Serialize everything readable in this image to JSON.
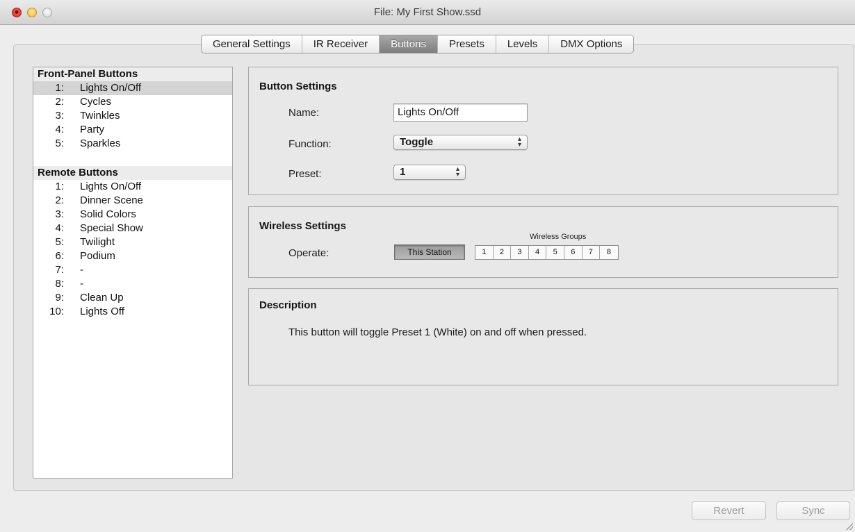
{
  "window": {
    "title": "File: My First Show.ssd"
  },
  "tabs": [
    {
      "label": "General Settings",
      "active": false
    },
    {
      "label": "IR Receiver",
      "active": false
    },
    {
      "label": "Buttons",
      "active": true
    },
    {
      "label": "Presets",
      "active": false
    },
    {
      "label": "Levels",
      "active": false
    },
    {
      "label": "DMX Options",
      "active": false
    }
  ],
  "sidebar": {
    "front_panel": {
      "header": "Front-Panel Buttons",
      "items": [
        {
          "num": "1:",
          "label": "Lights On/Off",
          "selected": true
        },
        {
          "num": "2:",
          "label": "Cycles",
          "selected": false
        },
        {
          "num": "3:",
          "label": "Twinkles",
          "selected": false
        },
        {
          "num": "4:",
          "label": "Party",
          "selected": false
        },
        {
          "num": "5:",
          "label": "Sparkles",
          "selected": false
        }
      ]
    },
    "remote": {
      "header": "Remote Buttons",
      "items": [
        {
          "num": "1:",
          "label": "Lights On/Off"
        },
        {
          "num": "2:",
          "label": "Dinner Scene"
        },
        {
          "num": "3:",
          "label": "Solid Colors"
        },
        {
          "num": "4:",
          "label": "Special Show"
        },
        {
          "num": "5:",
          "label": "Twilight"
        },
        {
          "num": "6:",
          "label": "Podium"
        },
        {
          "num": "7:",
          "label": "-"
        },
        {
          "num": "8:",
          "label": "-"
        },
        {
          "num": "9:",
          "label": "Clean Up"
        },
        {
          "num": "10:",
          "label": "Lights Off"
        }
      ]
    }
  },
  "button_settings": {
    "title": "Button Settings",
    "name_label": "Name:",
    "name_value": "Lights On/Off",
    "function_label": "Function:",
    "function_value": "Toggle",
    "preset_label": "Preset:",
    "preset_value": "1"
  },
  "wireless_settings": {
    "title": "Wireless Settings",
    "operate_label": "Operate:",
    "station_button": "This Station",
    "groups_caption": "Wireless Groups",
    "groups": [
      "1",
      "2",
      "3",
      "4",
      "5",
      "6",
      "7",
      "8"
    ]
  },
  "description": {
    "title": "Description",
    "text": "This button will toggle Preset 1 (White) on and off when pressed."
  },
  "footer": {
    "revert_label": "Revert",
    "sync_label": "Sync"
  },
  "colors": {
    "window_bg": "#ededed",
    "selected_row": "#d4d4d4",
    "active_tab": "#8f8f8f"
  },
  "icons": [
    "close-window-icon",
    "minimize-window-icon",
    "zoom-window-icon",
    "popup-arrows-icon",
    "resize-grip-icon"
  ]
}
